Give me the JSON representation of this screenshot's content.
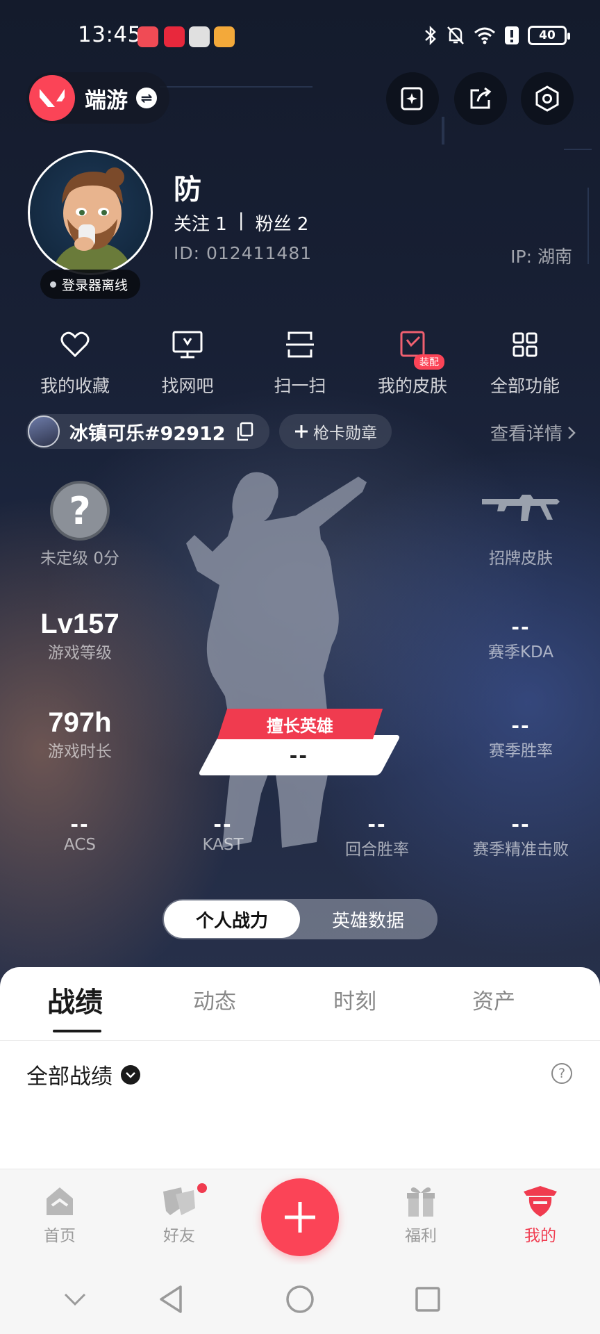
{
  "status_bar": {
    "time": "13:45",
    "battery": "40"
  },
  "header": {
    "mode_label": "端游",
    "swap_icon": "⇌"
  },
  "profile": {
    "username": "防",
    "follow_label": "关注",
    "follow_count": "1",
    "separator": "|",
    "fans_label": "粉丝",
    "fans_count": "2",
    "id_text": "ID:  012411481",
    "ip_text": "IP:  湖南",
    "offline_status": "登录器离线"
  },
  "shortcuts": [
    {
      "label": "我的收藏",
      "icon": "heart-icon"
    },
    {
      "label": "找网吧",
      "icon": "monitor-icon"
    },
    {
      "label": "扫一扫",
      "icon": "scan-icon"
    },
    {
      "label": "我的皮肤",
      "icon": "skin-icon",
      "badge": "装配"
    },
    {
      "label": "全部功能",
      "icon": "grid-icon"
    }
  ],
  "account": {
    "riot_id": "冰镇可乐#92912",
    "card_button": "枪卡勋章",
    "details_link": "查看详情"
  },
  "stats": {
    "rank_symbol": "?",
    "rank_label": "未定级 0分",
    "signature_skin_label": "招牌皮肤",
    "level_value": "Lv157",
    "level_label": "游戏等级",
    "kda_value": "--",
    "kda_label": "赛季KDA",
    "hours_value": "797h",
    "hours_label": "游戏时长",
    "winrate_value": "--",
    "winrate_label": "赛季胜率",
    "best_hero_tag": "擅长英雄",
    "best_hero_value": "--",
    "acs_value": "--",
    "acs_label": "ACS",
    "kast_value": "--",
    "kast_label": "KAST",
    "round_win_value": "--",
    "round_win_label": "回合胜率",
    "precise_kill_value": "--",
    "precise_kill_label": "赛季精准击败"
  },
  "toggle": {
    "active": "个人战力",
    "inactive": "英雄数据"
  },
  "tabs": [
    {
      "label": "战绩",
      "active": true
    },
    {
      "label": "动态",
      "active": false
    },
    {
      "label": "时刻",
      "active": false
    },
    {
      "label": "资产",
      "active": false
    }
  ],
  "filter": {
    "label": "全部战绩",
    "help": "?"
  },
  "bottom_nav": [
    {
      "label": "首页",
      "icon": "home-icon",
      "active": false
    },
    {
      "label": "好友",
      "icon": "friends-icon",
      "active": false,
      "has_dot": true
    },
    {
      "label": "福利",
      "icon": "gift-icon",
      "active": false
    },
    {
      "label": "我的",
      "icon": "profile-icon",
      "active": true
    }
  ],
  "colors": {
    "accent": "#fb4457",
    "hero_bg": "#182035"
  }
}
